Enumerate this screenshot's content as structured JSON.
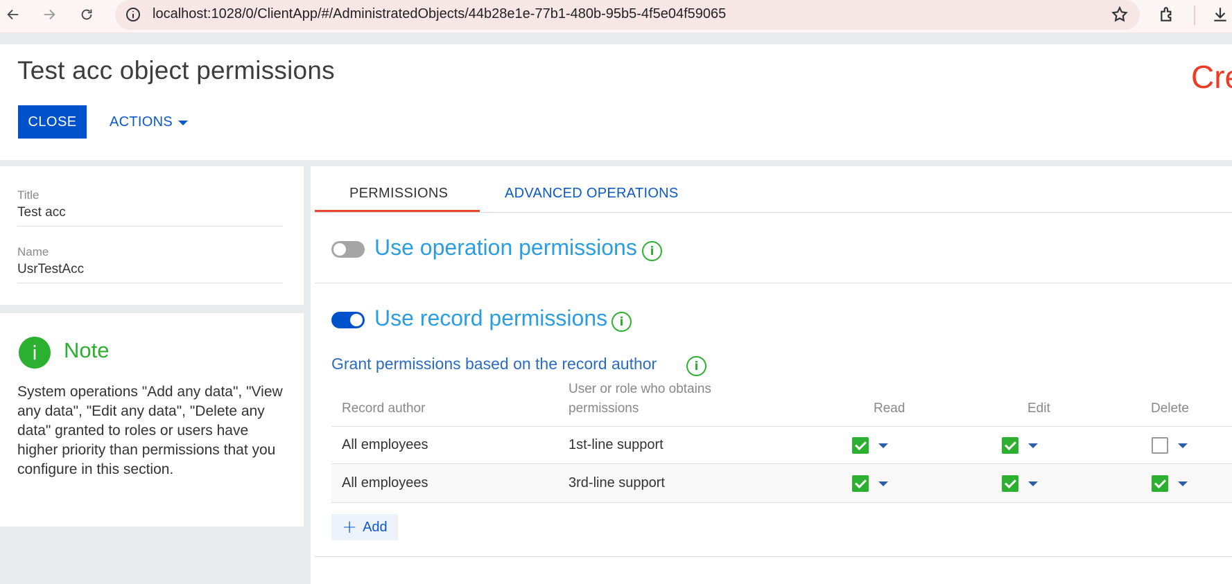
{
  "browser": {
    "url": "localhost:1028/0/ClientApp/#/AdministratedObjects/44b28e1e-77b1-480b-95b5-4f5e04f59065"
  },
  "header": {
    "title": "Test acc object permissions",
    "brand": "Cre",
    "close_label": "CLOSE",
    "actions_label": "ACTIONS"
  },
  "details": {
    "title_label": "Title",
    "title_value": "Test acc",
    "name_label": "Name",
    "name_value": "UsrTestAcc"
  },
  "note": {
    "icon": "i",
    "title": "Note",
    "text": "System operations \"Add any data\", \"View any data\", \"Edit any data\", \"Delete any data\" granted to roles or users have higher priority than permissions that you configure in this section."
  },
  "tabs": [
    {
      "label": "PERMISSIONS"
    },
    {
      "label": "ADVANCED OPERATIONS"
    }
  ],
  "operation_permissions": {
    "label": "Use operation permissions",
    "enabled": false
  },
  "record_permissions": {
    "label": "Use record permissions",
    "enabled": true,
    "grant_title": "Grant permissions based on the record author",
    "columns": {
      "author": "Record author",
      "grantee": "User or role who obtains permissions",
      "read": "Read",
      "edit": "Edit",
      "delete": "Delete"
    },
    "rows": [
      {
        "author": "All employees",
        "grantee": "1st-line support",
        "read": true,
        "edit": true,
        "delete": false
      },
      {
        "author": "All employees",
        "grantee": "3rd-line support",
        "read": true,
        "edit": true,
        "delete": true
      }
    ],
    "add_label": "Add"
  },
  "info_icon": "i"
}
